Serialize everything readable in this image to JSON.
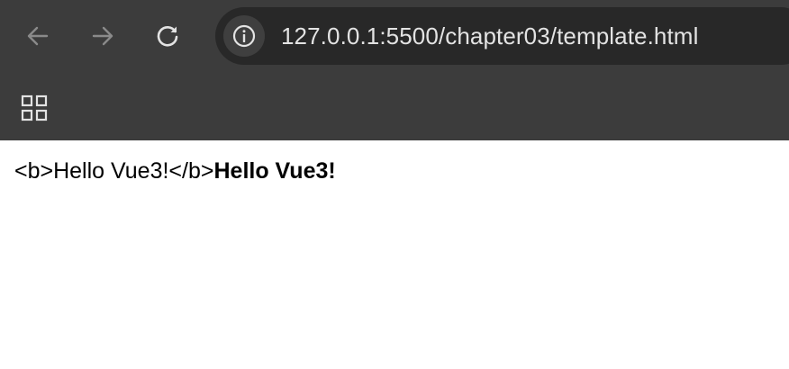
{
  "browser": {
    "url": "127.0.0.1:5500/chapter03/template.html",
    "icons": {
      "back": "arrow-left-icon",
      "forward": "arrow-right-icon",
      "reload": "reload-icon",
      "site_info": "info-icon",
      "apps": "grid-icon"
    },
    "colors": {
      "chrome_bg": "#3c3c3c",
      "omnibox_bg": "#282828",
      "url_text": "#e3e3e3",
      "icon_disabled": "#8a8a8a",
      "icon_active": "#e3e3e3"
    }
  },
  "page": {
    "raw_text": "<b>Hello Vue3!</b>",
    "bold_text": "Hello Vue3!"
  }
}
